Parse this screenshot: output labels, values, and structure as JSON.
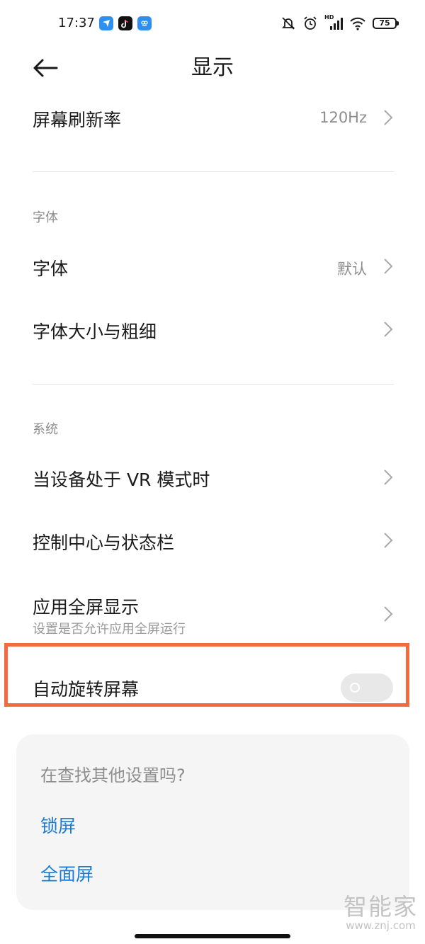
{
  "status_bar": {
    "time": "17:37",
    "app_icons": [
      "feishu-icon",
      "tiktok-icon",
      "wallet-icon"
    ],
    "battery": "75",
    "network_badge": "HD"
  },
  "header": {
    "title": "显示",
    "back_icon": "arrow-left-icon"
  },
  "items": {
    "refresh_rate": {
      "label": "屏幕刷新率",
      "value": "120Hz"
    },
    "font_section": "字体",
    "font": {
      "label": "字体",
      "value": "默认"
    },
    "font_size": {
      "label": "字体大小与粗细"
    },
    "system_section": "系统",
    "vr_mode": {
      "label": "当设备处于 VR 模式时"
    },
    "control_center": {
      "label": "控制中心与状态栏"
    },
    "fullscreen": {
      "label": "应用全屏显示",
      "subtitle": "设置是否允许应用全屏运行"
    },
    "auto_rotate": {
      "label": "自动旋转屏幕",
      "enabled": false
    }
  },
  "search_card": {
    "title": "在查找其他设置吗?",
    "links": [
      "锁屏",
      "全面屏"
    ]
  },
  "watermark": {
    "main": "智能家",
    "sub": "www.znj.com"
  },
  "colors": {
    "accent_link": "#1a7cd6",
    "highlight_border": "#f36b3e",
    "toggle_off": "#e8e8e8"
  }
}
